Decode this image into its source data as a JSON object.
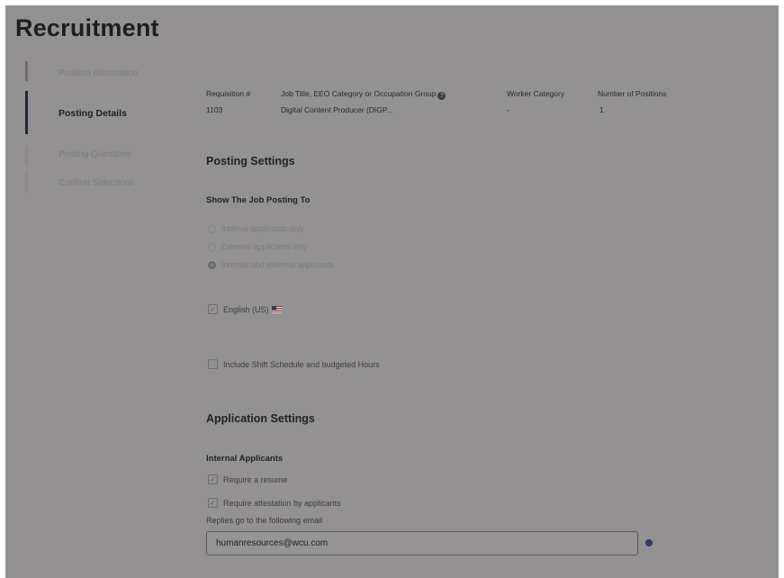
{
  "page": {
    "title": "Recruitment"
  },
  "sidebar": {
    "items": [
      {
        "label": "Position Information",
        "active": false
      },
      {
        "label": "Posting Details",
        "active": true
      },
      {
        "label": "Posting Questions",
        "active": false
      },
      {
        "label": "Confirm Selections",
        "active": false
      }
    ]
  },
  "header": {
    "columns": [
      {
        "label": "Requisition #",
        "value": "1103"
      },
      {
        "label": "Job Title, EEO Category or Occupation Group",
        "value": "Digital Content Producer (DIGP..."
      },
      {
        "label": "Worker Category",
        "value": "-"
      },
      {
        "label": "Number of Positions",
        "value": "1"
      }
    ],
    "help_icon": "question-icon"
  },
  "posting_settings": {
    "heading": "Posting Settings",
    "show_to_label": "Show The Job Posting To",
    "options": [
      {
        "label": "Internal applicants only",
        "selected": false
      },
      {
        "label": "External applicants only",
        "selected": false
      },
      {
        "label": "Internal and external applicants",
        "selected": true
      }
    ],
    "language_label": "English (US)",
    "language_icon": "us-flag-icon",
    "shift_label": "Include Shift Schedule and budgeted Hours"
  },
  "application_settings": {
    "heading": "Application Settings",
    "internal_label": "Internal Applicants",
    "require_resume": "Require a resume",
    "require_attestation": "Require attestation by applicants",
    "reply_label": "Replies go to the following email",
    "reply_email": "humanresources@wcu.com"
  }
}
